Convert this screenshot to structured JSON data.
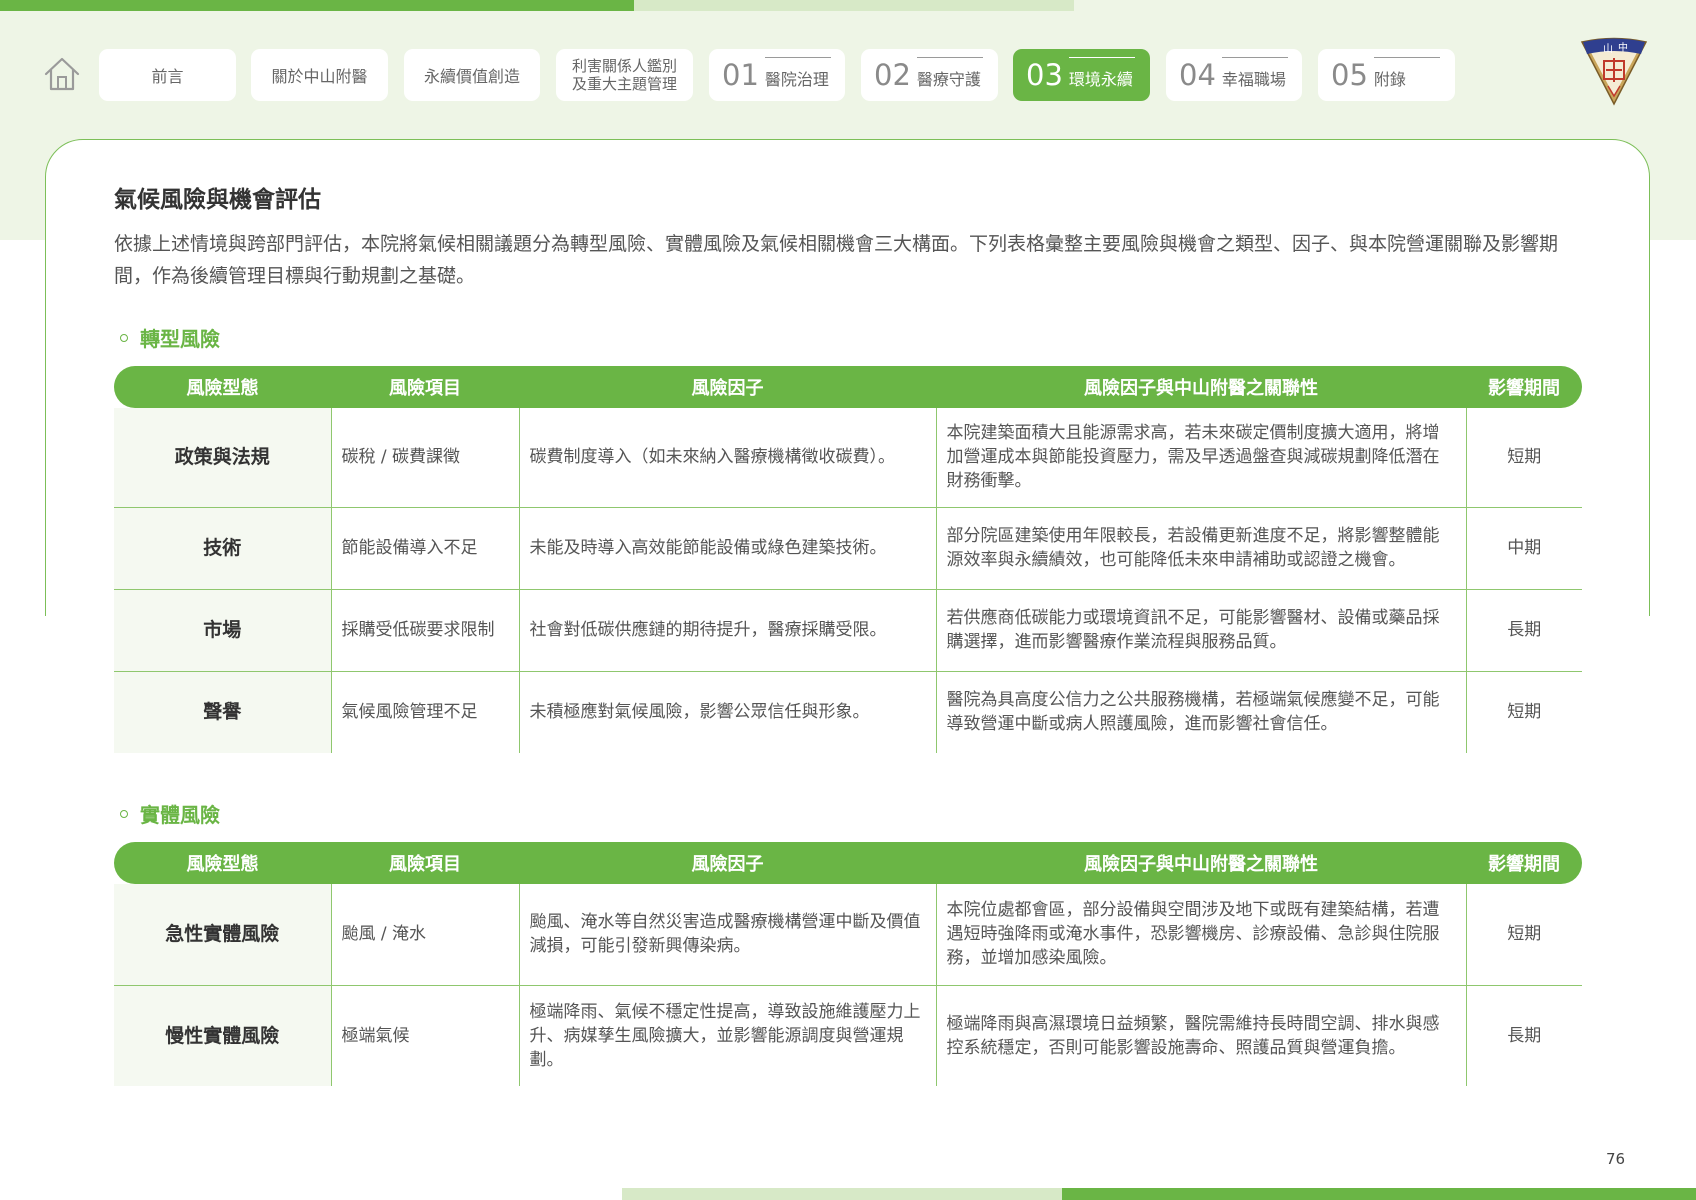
{
  "nav": {
    "tabs": [
      {
        "label": "前言"
      },
      {
        "label": "關於中山附醫"
      },
      {
        "label": "永續價值創造"
      },
      {
        "label_line1": "利害關係人鑑別",
        "label_line2": "及重大主題管理"
      },
      {
        "num": "01",
        "label": "醫院治理"
      },
      {
        "num": "02",
        "label": "醫療守護"
      },
      {
        "num": "03",
        "label": "環境永續"
      },
      {
        "num": "04",
        "label": "幸福職場"
      },
      {
        "num": "05",
        "label": "附錄"
      }
    ]
  },
  "logo": {
    "text": "中山"
  },
  "page": {
    "title": "氣候風險與機會評估",
    "intro": "依據上述情境與跨部門評估，本院將氣候相關議題分為轉型風險、實體風險及氣候相關機會三大構面。下列表格彙整主要風險與機會之類型、因子、與本院營運關聯及影響期間，作為後續管理目標與行動規劃之基礎。",
    "page_number": "76"
  },
  "columns": [
    "風險型態",
    "風險項目",
    "風險因子",
    "風險因子與中山附醫之關聯性",
    "影響期間"
  ],
  "transition": {
    "title": "轉型風險",
    "rows": [
      {
        "type": "政策與法規",
        "item": "碳稅 / 碳費課徵",
        "factor": "碳費制度導入（如未來納入醫療機構徵收碳費）。",
        "relation": "本院建築面積大且能源需求高，若未來碳定價制度擴大適用，將增加營運成本與節能投資壓力，需及早透過盤查與減碳規劃降低潛在財務衝擊。",
        "period": "短期"
      },
      {
        "type": "技術",
        "item": "節能設備導入不足",
        "factor": "未能及時導入高效能節能設備或綠色建築技術。",
        "relation": "部分院區建築使用年限較長，若設備更新進度不足，將影響整體能源效率與永續績效，也可能降低未來申請補助或認證之機會。",
        "period": "中期"
      },
      {
        "type": "市場",
        "item": "採購受低碳要求限制",
        "factor": "社會對低碳供應鏈的期待提升，醫療採購受限。",
        "relation": "若供應商低碳能力或環境資訊不足，可能影響醫材、設備或藥品採購選擇，進而影響醫療作業流程與服務品質。",
        "period": "長期"
      },
      {
        "type": "聲譽",
        "item": "氣候風險管理不足",
        "factor": "未積極應對氣候風險，影響公眾信任與形象。",
        "relation": "醫院為具高度公信力之公共服務機構，若極端氣候應變不足，可能導致營運中斷或病人照護風險，進而影響社會信任。",
        "period": "短期"
      }
    ]
  },
  "physical": {
    "title": "實體風險",
    "rows": [
      {
        "type": "急性實體風險",
        "item": "颱風 / 淹水",
        "factor": "颱風、淹水等自然災害造成醫療機構營運中斷及價值減損，可能引發新興傳染病。",
        "relation": "本院位處都會區，部分設備與空間涉及地下或既有建築結構，若遭遇短時強降雨或淹水事件，恐影響機房、診療設備、急診與住院服務，並增加感染風險。",
        "period": "短期"
      },
      {
        "type": "慢性實體風險",
        "item": "極端氣候",
        "factor": "極端降雨、氣候不穩定性提高，導致設施維護壓力上升、病媒孳生風險擴大，並影響能源調度與營運規劃。",
        "relation": "極端降雨與高濕環境日益頻繁，醫院需維持長時間空調、排水與感控系統穩定，否則可能影響設施壽命、照護品質與營運負擔。",
        "period": "長期"
      }
    ]
  },
  "colors": {
    "accent": "#6ab545",
    "accent_light": "#d7e9c7",
    "band": "#eef5e6"
  }
}
